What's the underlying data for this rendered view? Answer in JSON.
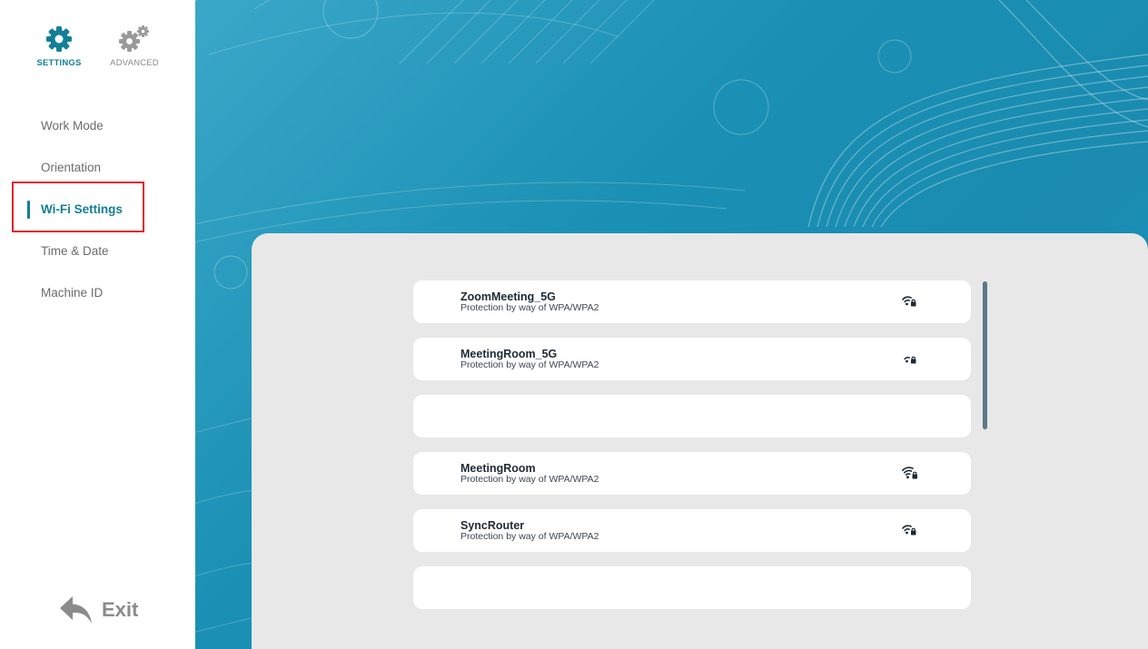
{
  "tabs": {
    "settings_label": "SETTINGS",
    "advanced_label": "ADVANCED"
  },
  "menu": {
    "items": [
      {
        "label": "Work Mode",
        "active": false
      },
      {
        "label": "Orientation",
        "active": false
      },
      {
        "label": "Wi-Fi Settings",
        "active": true
      },
      {
        "label": "Time & Date",
        "active": false
      },
      {
        "label": "Machine ID",
        "active": false
      }
    ]
  },
  "exit_label": "Exit",
  "networks": [
    {
      "name": "ZoomMeeting_5G",
      "security": "Protection by way of WPA/WPA2",
      "signal_bars": 2,
      "icon": "wifi-lock-icon"
    },
    {
      "name": "MeetingRoom_5G",
      "security": "Protection by way of WPA/WPA2",
      "signal_bars": 1,
      "icon": "wifi-lock-icon"
    },
    {
      "name": "",
      "security": "",
      "signal_bars": 0,
      "icon": ""
    },
    {
      "name": "MeetingRoom",
      "security": "Protection by way of WPA/WPA2",
      "signal_bars": 3,
      "icon": "wifi-lock-icon"
    },
    {
      "name": "SyncRouter",
      "security": "Protection by way of WPA/WPA2",
      "signal_bars": 2,
      "icon": "wifi-lock-icon"
    },
    {
      "name": "",
      "security": "",
      "signal_bars": 0,
      "icon": ""
    }
  ],
  "colors": {
    "accent": "#137f97",
    "highlight": "#e0242a",
    "hero": "#1b8bb0",
    "panel": "#e8e8e8"
  }
}
